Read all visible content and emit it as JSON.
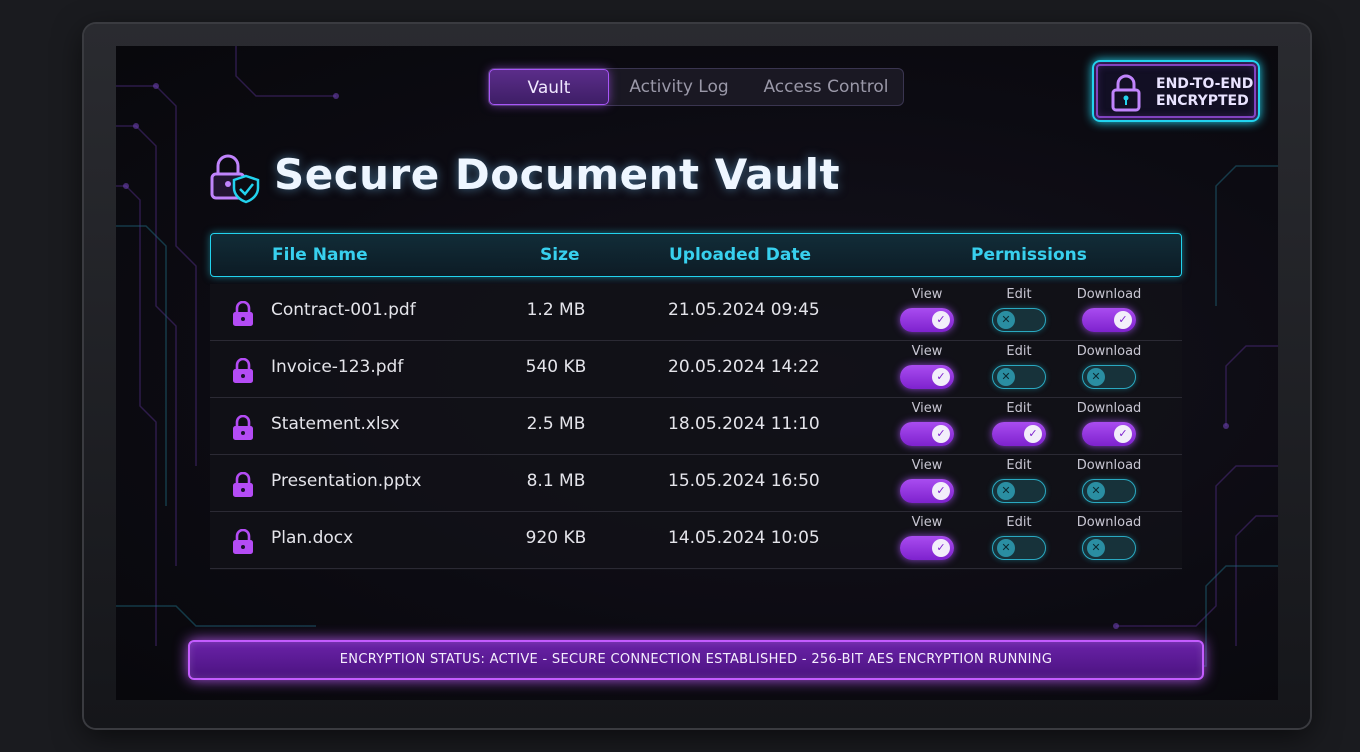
{
  "tabs": [
    {
      "label": "Vault",
      "active": true
    },
    {
      "label": "Activity Log",
      "active": false
    },
    {
      "label": "Access Control",
      "active": false
    }
  ],
  "badge": {
    "line1": "END-TO-END",
    "line2": "ENCRYPTED",
    "icon": "lock-icon"
  },
  "page_title": "Secure Document Vault",
  "table": {
    "columns": [
      "File Name",
      "Size",
      "Uploaded Date",
      "Permissions"
    ],
    "permission_labels": [
      "View",
      "Edit",
      "Download"
    ],
    "rows": [
      {
        "name": "Contract-001.pdf",
        "size": "1.2 MB",
        "date": "21.05.2024 09:45",
        "view": true,
        "edit": false,
        "download": true
      },
      {
        "name": "Invoice-123.pdf",
        "size": "540 KB",
        "date": "20.05.2024 14:22",
        "view": true,
        "edit": false,
        "download": false
      },
      {
        "name": "Statement.xlsx",
        "size": "2.5 MB",
        "date": "18.05.2024 11:10",
        "view": true,
        "edit": true,
        "download": true
      },
      {
        "name": "Presentation.pptx",
        "size": "8.1 MB",
        "date": "15.05.2024 16:50",
        "view": true,
        "edit": false,
        "download": false
      },
      {
        "name": "Plan.docx",
        "size": "920 KB",
        "date": "14.05.2024 10:05",
        "view": true,
        "edit": false,
        "download": false
      }
    ]
  },
  "status": {
    "text": "ENCRYPTION STATUS: ACTIVE - SECURE CONNECTION ESTABLISHED - 256-BIT AES ENCRYPTION RUNNING"
  },
  "colors": {
    "accent_purple": "#a855f7",
    "accent_cyan": "#22d3ee",
    "background": "#0c0b12"
  }
}
